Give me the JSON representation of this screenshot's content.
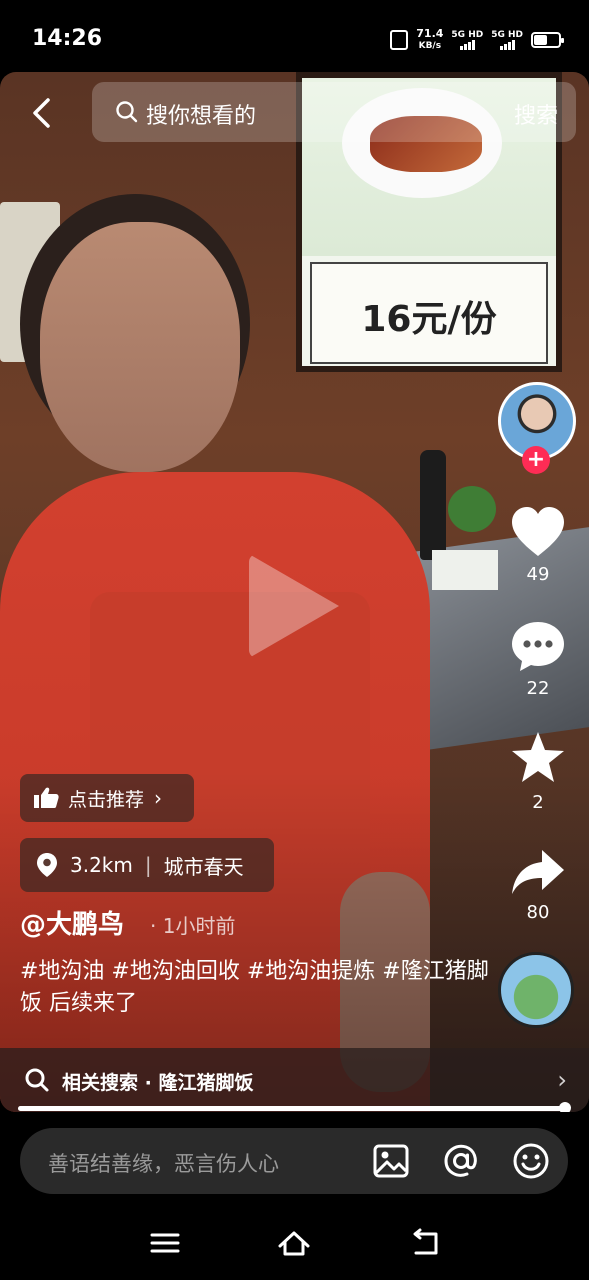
{
  "status_bar": {
    "time": "14:26",
    "net_speed_value": "71.4",
    "net_speed_unit": "KB/s",
    "sim1": "5G HD",
    "sim2": "5G HD",
    "battery_level": 0.6
  },
  "search": {
    "placeholder": "搜你想看的",
    "button": "搜索"
  },
  "video": {
    "poster_price": "16元/份",
    "progress": 0.998
  },
  "rail": {
    "likes": "49",
    "comments": "22",
    "favorites": "2",
    "shares": "80",
    "follow_symbol": "+"
  },
  "info": {
    "recommend_label": "点击推荐",
    "distance": "3.2km",
    "place": "城市春天",
    "author": "@大鹏鸟",
    "time_ago": "· 1小时前",
    "caption": "#地沟油 #地沟油回收 #地沟油提炼 #隆江猪脚饭 后续来了"
  },
  "related": {
    "label": "相关搜索 · 隆江猪脚饭"
  },
  "comment": {
    "placeholder": "善语结善缘，恶言伤人心"
  },
  "colors": {
    "accent": "#fe2c55",
    "background": "#000000"
  }
}
